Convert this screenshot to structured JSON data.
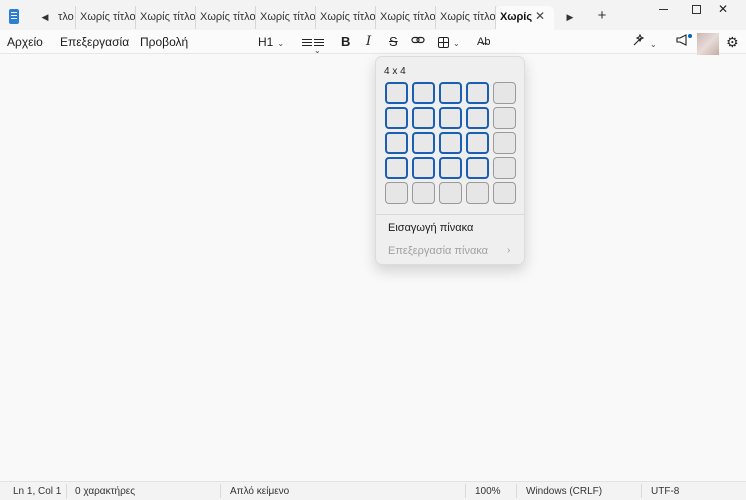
{
  "tabs": {
    "partial_first": "τλο",
    "items": [
      "Χωρίς τίτλο",
      "Χωρίς τίτλο",
      "Χωρίς τίτλο",
      "Χωρίς τίτλο",
      "Χωρίς τίτλο",
      "Χωρίς τίτλο",
      "Χωρίς τίτλο"
    ],
    "active": "Χωρίς"
  },
  "menu": {
    "file": "Αρχείο",
    "edit": "Επεξεργασία",
    "view": "Προβολή"
  },
  "toolbar": {
    "heading": "H1",
    "bold": "B",
    "italic": "I",
    "strike": "S",
    "spell": "A̶b"
  },
  "table_picker": {
    "size_label": "4 x 4",
    "rows": 5,
    "cols": 5,
    "selected_rows": 4,
    "selected_cols": 4,
    "insert_label": "Εισαγωγή πίνακα",
    "edit_label": "Επεξεργασία πίνακα"
  },
  "status": {
    "position": "Ln 1, Col 1",
    "chars": "0 χαρακτήρες",
    "format": "Απλό κείμενο",
    "zoom": "100%",
    "line_ending": "Windows (CRLF)",
    "encoding": "UTF-8"
  },
  "icons": {
    "app": "notepad-icon",
    "link": "link-icon",
    "table": "table-icon",
    "ai": "copilot-icon",
    "announce": "megaphone-icon",
    "settings": "gear-icon"
  },
  "colors": {
    "accent": "#1a5fb4",
    "notification_dot": "#0067c0"
  }
}
